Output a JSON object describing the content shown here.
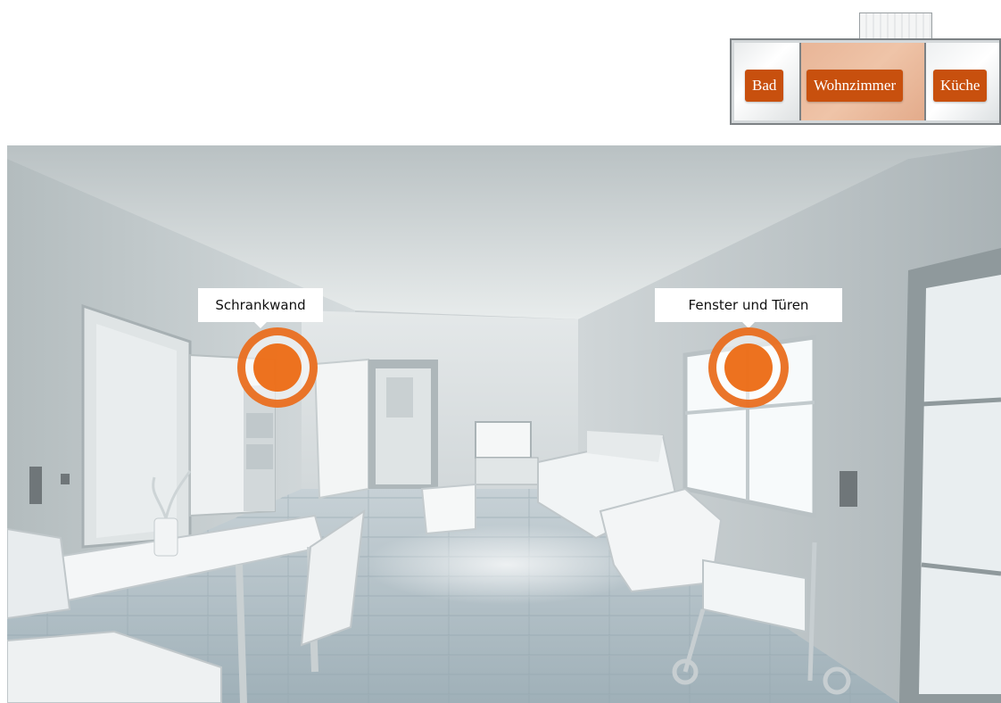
{
  "floorplan": {
    "rooms": [
      {
        "label": "Bad"
      },
      {
        "label": "Wohnzimmer",
        "active": true
      },
      {
        "label": "Küche"
      }
    ],
    "active_color": "#e8b597",
    "button_color": "#c8500e"
  },
  "scene": {
    "hotspots": [
      {
        "label": "Schrankwand",
        "icon": "hotspot-target-icon"
      },
      {
        "label": "Fenster und Türen",
        "icon": "hotspot-target-icon"
      }
    ],
    "accent_color": "#ec6c16"
  }
}
